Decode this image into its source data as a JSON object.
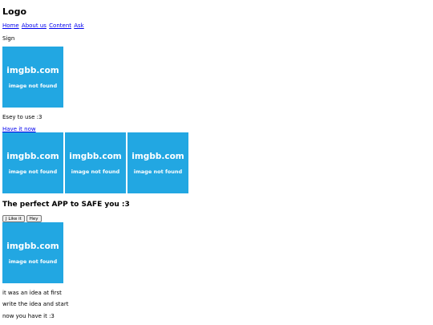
{
  "header": {
    "logo": "Logo"
  },
  "nav": {
    "items": [
      {
        "label": "Home"
      },
      {
        "label": "About us"
      },
      {
        "label": "Content"
      },
      {
        "label": "Ask"
      }
    ]
  },
  "sign": {
    "label": "Sign"
  },
  "placeholder": {
    "brand": "imgbb.com",
    "message": "image not found"
  },
  "intro": {
    "text": "Esey to use :3",
    "link": "Have it now"
  },
  "tagline": {
    "heading": "The perfect APP to SAFE you :3"
  },
  "buttons": {
    "like": "J Like it",
    "hey": "Hey"
  },
  "story": {
    "lines": [
      "it was an idea at first",
      "write the idea and start",
      "now you have it :3"
    ]
  },
  "colors": {
    "placeholder_bg": "#22a7e2",
    "link": "#0000ee"
  }
}
